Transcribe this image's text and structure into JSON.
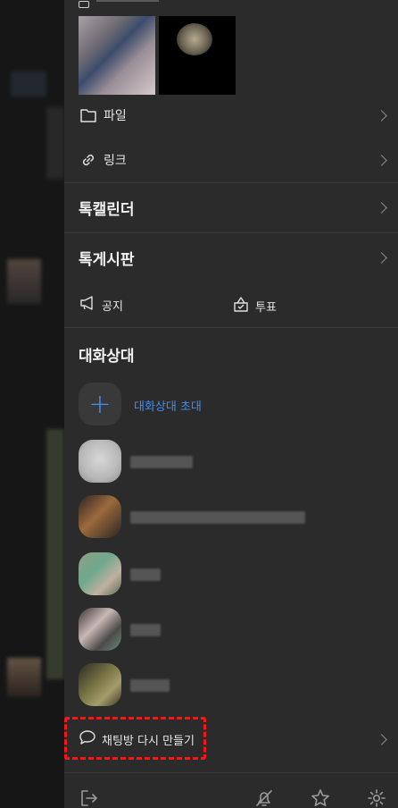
{
  "drawer": {
    "file_label": "파일",
    "link_label": "링크",
    "calendar_label": "톡캘린더",
    "board_label": "톡게시판",
    "notice_label": "공지",
    "vote_label": "투표",
    "members_title": "대화상대",
    "invite_label": "대화상대 초대",
    "recreate_label": "채팅방 다시 만들기"
  },
  "icons": {
    "file": "folder-icon",
    "link": "link-icon",
    "notice": "megaphone-icon",
    "vote": "ballot-box-icon",
    "invite": "plus-icon",
    "recreate": "speech-bubble-icon",
    "exit": "exit-icon",
    "mute": "bell-off-icon",
    "favorite": "star-icon",
    "settings": "gear-icon"
  },
  "colors": {
    "accent": "#3e8ef7",
    "highlight_box": "#ff1313",
    "panel_bg": "#2b2b2b"
  }
}
